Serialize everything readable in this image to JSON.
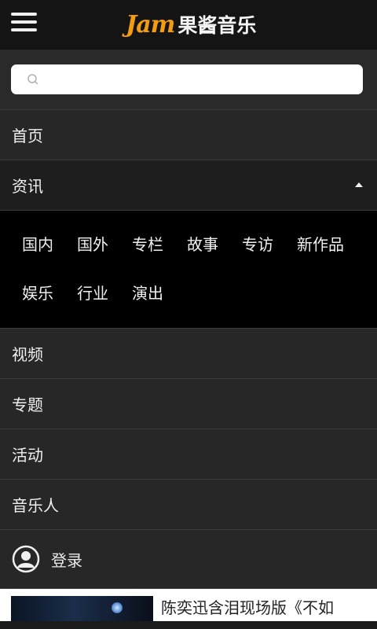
{
  "header": {
    "logo_en": "Jam",
    "logo_cn": "果酱音乐"
  },
  "search": {
    "placeholder": ""
  },
  "nav": {
    "home": "首页",
    "news": "资讯",
    "video": "视频",
    "topics": "专题",
    "events": "活动",
    "musicians": "音乐人",
    "login": "登录"
  },
  "news_submenu": {
    "row1": [
      "国内",
      "国外",
      "专栏",
      "故事",
      "专访",
      "新作品"
    ],
    "row2": [
      "娱乐",
      "行业",
      "演出"
    ]
  },
  "article": {
    "title": "陈奕迅含泪现场版《不如"
  },
  "colors": {
    "accent": "#f39c12",
    "menu_bg": "#272727",
    "submenu_bg": "#000000"
  }
}
